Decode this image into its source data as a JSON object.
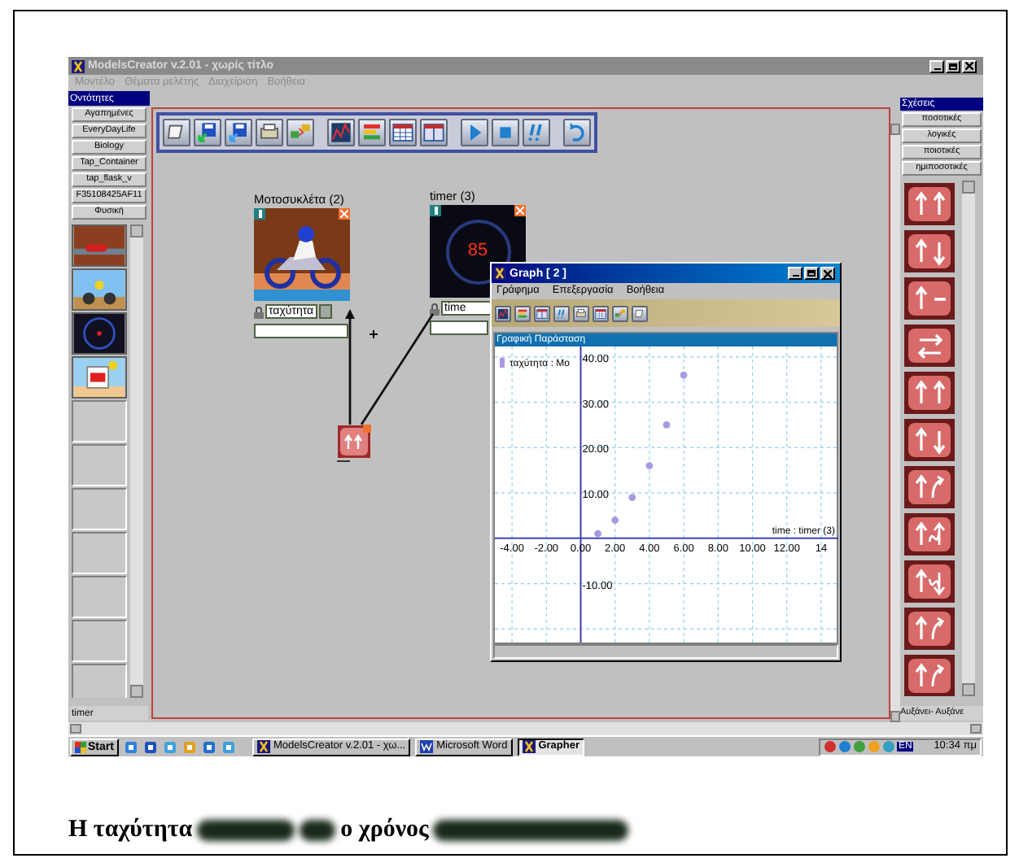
{
  "app_window": {
    "title": "ModelsCreator v.2.01 - χωρίς τίτλο",
    "menu": [
      "Μοντέλο",
      "Θέματα μελέτης",
      "Διαχείριση",
      "Βοήθεια"
    ]
  },
  "entities_panel": {
    "title": "Οντότητες",
    "categories": [
      "Αγαπημένες",
      "EveryDayLife",
      "Biology",
      "Tap_Container",
      "tap_flask_v",
      "F35108425AF11",
      "Φυσική"
    ],
    "selected_label": "timer"
  },
  "canvas": {
    "entities": [
      {
        "kind": "motorcycle",
        "title": "Μοτοσυκλέτα (2)",
        "variable": "ταχύτητα"
      },
      {
        "kind": "timer",
        "title": "timer (3)",
        "display": "85",
        "variable": "time"
      }
    ]
  },
  "graph_window": {
    "title": "Graph [ 2 ]",
    "menu": [
      "Γράφημα",
      "Επεξεργασία",
      "Βοήθεια"
    ],
    "panel_title": "Γραφική Παράσταση",
    "chart_data": {
      "type": "scatter",
      "xlabel": "time : timer (3)",
      "x": [
        1,
        2,
        3,
        4,
        5,
        6
      ],
      "series": [
        {
          "name": "ταχύτητα : Μο",
          "color": "#a89ae0",
          "values": [
            1,
            4,
            9,
            16,
            25,
            36
          ]
        }
      ],
      "xlim": [
        -5,
        15
      ],
      "grid": true,
      "ylim": [
        -23,
        42.3
      ],
      "xticks": [
        {
          "value": -4,
          "label": "-4.00"
        },
        {
          "value": -2,
          "label": "-2.00"
        },
        {
          "value": 0,
          "label": "0.00"
        },
        {
          "value": 2,
          "label": "2.00"
        },
        {
          "value": 4,
          "label": "4.00"
        },
        {
          "value": 6,
          "label": "6.00"
        },
        {
          "value": 8,
          "label": "8.00"
        },
        {
          "value": 10,
          "label": "10.00"
        },
        {
          "value": 12,
          "label": "12.00"
        },
        {
          "value": 14,
          "label": "14"
        }
      ],
      "yticks": [
        {
          "value": 40,
          "label": "40.00"
        },
        {
          "value": 30,
          "label": "30.00"
        },
        {
          "value": 20,
          "label": "20.00"
        },
        {
          "value": 10,
          "label": "10.00"
        },
        {
          "value": -10,
          "label": "-10.00"
        }
      ]
    }
  },
  "relations_panel": {
    "title": "Σχέσεις",
    "categories": [
      "ποσοτικές",
      "λογικές",
      "ποιοτικές",
      "ημιποσοτικές"
    ],
    "footer": "Αυξάνει- Αυξάνε"
  },
  "taskbar": {
    "start": "Start",
    "tasks": [
      {
        "label": "ModelsCreator v.2.01 - χω...",
        "selected": false
      },
      {
        "label": "Microsoft Word",
        "selected": false
      },
      {
        "label": "Grapher",
        "selected": true
      }
    ],
    "language": "EN",
    "clock": "10:34 πμ"
  },
  "caption": {
    "parts": [
      {
        "kind": "text",
        "text": "Η ταχύτητα"
      },
      {
        "kind": "blurred"
      },
      {
        "kind": "blurred"
      },
      {
        "kind": "text",
        "text": "ο χρόνος"
      },
      {
        "kind": "blurred"
      }
    ]
  }
}
